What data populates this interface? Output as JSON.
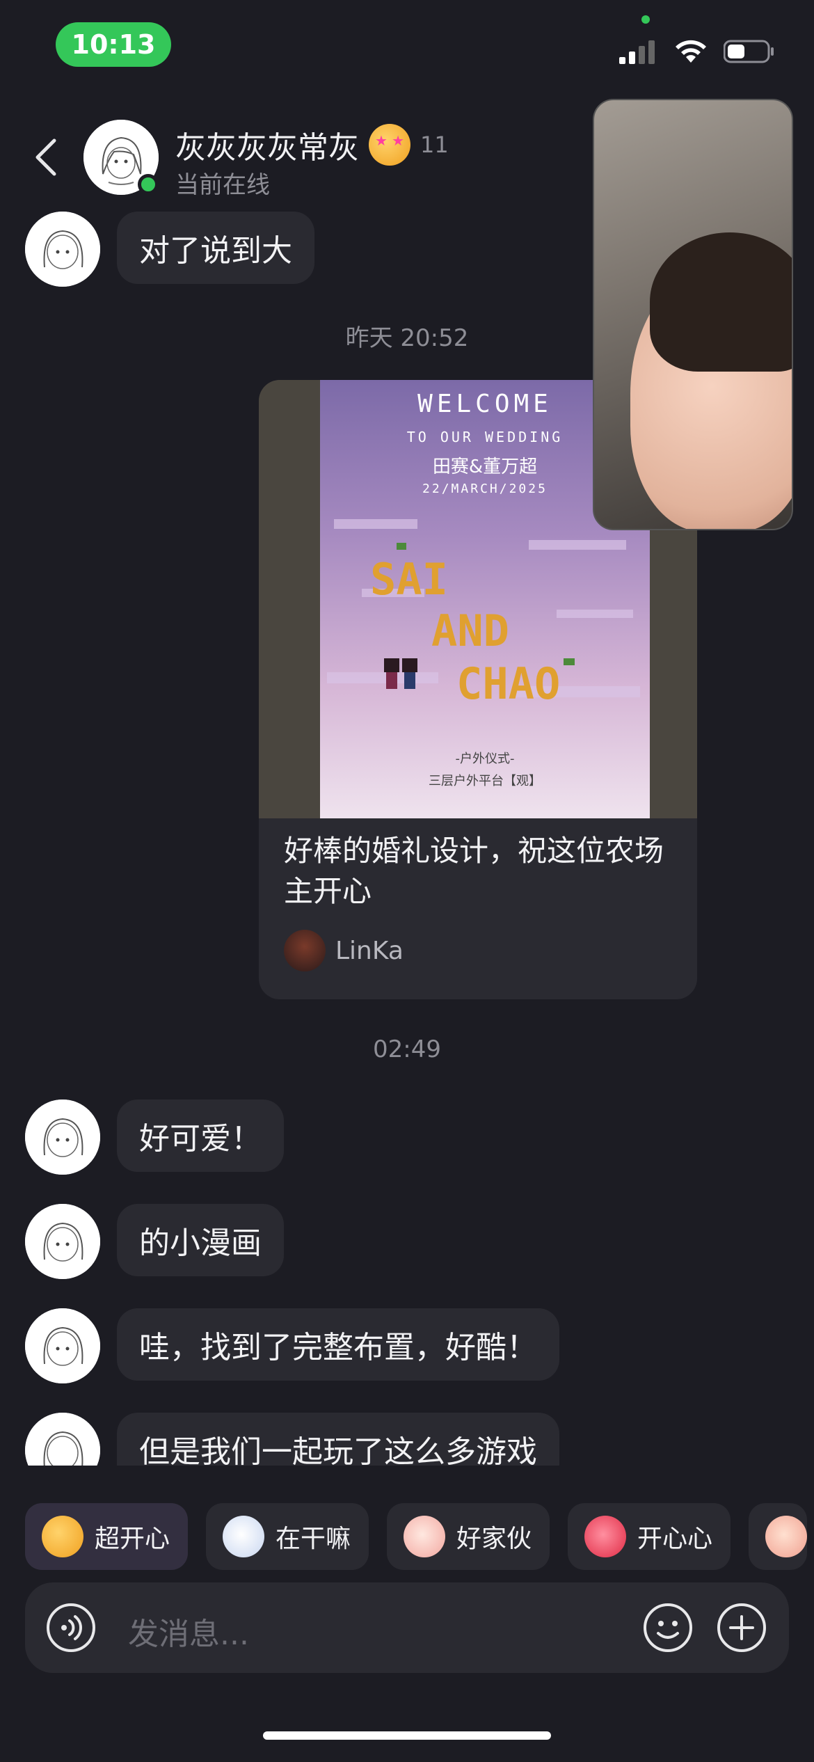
{
  "status": {
    "time": "10:13"
  },
  "header": {
    "name": "灰灰灰灰常灰",
    "level": "11",
    "status_text": "当前在线"
  },
  "messages": {
    "m0": "对了说到大",
    "ts1": "昨天 20:52",
    "card": {
      "title": "好棒的婚礼设计，祝这位农场主开心",
      "author": "LinKa"
    },
    "ts2": "02:49",
    "m1": "好可爱！",
    "m2": "的小漫画",
    "m3": "哇，找到了完整布置，好酷！",
    "m4": "但是我们一起玩了这么多游戏"
  },
  "poster": {
    "welcome": "WELCOME",
    "to_our": "TO OUR WEDDING",
    "names": "田赛&董万超",
    "date": "22/MARCH/2025",
    "sai": "SAI",
    "and": "AND",
    "chao": "CHAO",
    "ceremony": "-户外仪式-",
    "venue": "三层户外平台【观】"
  },
  "quick_replies": [
    "超开心",
    "在干嘛",
    "好家伙",
    "开心心"
  ],
  "input": {
    "placeholder": "发消息..."
  },
  "colors": {
    "background": "#1c1c23",
    "bubble": "#2a2a31",
    "online": "#34c759"
  }
}
